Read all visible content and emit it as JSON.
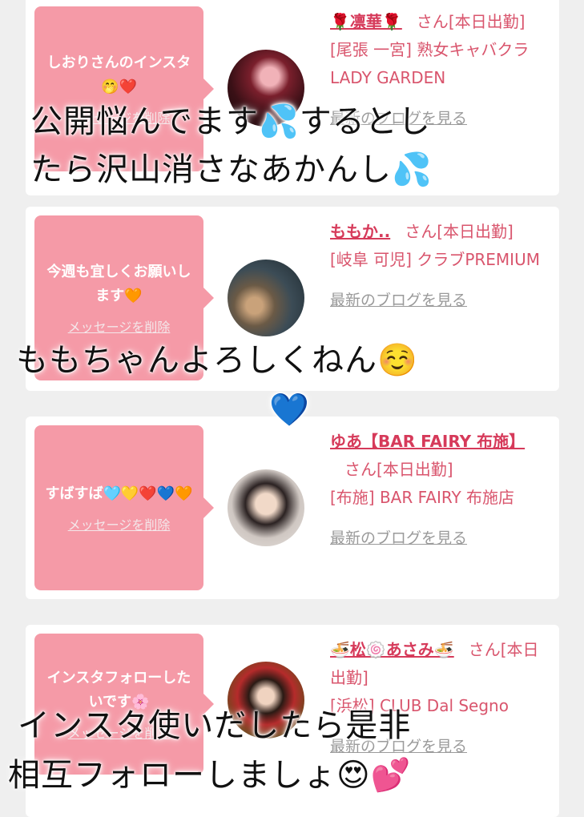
{
  "cards": [
    {
      "bubble_message": "しおりさんのインスタ🤭❤️",
      "delete_label": "メッセージを削除",
      "name": "🌹凛華🌹",
      "honorific": "さん",
      "status": "[本日出勤]",
      "location": "[尾張 一宮] 熟女キャバクラ LADY GARDEN",
      "blog_link": "最新のブログを見る"
    },
    {
      "bubble_message": "今週も宜しくお願いします🧡",
      "delete_label": "メッセージを削除",
      "name": "ももか..",
      "honorific": "さん",
      "status": "[本日出勤]",
      "location": "[岐阜 可児] クラブPREMIUM",
      "blog_link": "最新のブログを見る"
    },
    {
      "bubble_message": "すばすば🩵💛❤️💙🧡",
      "delete_label": "メッセージを削除",
      "name": "ゆあ【BAR FAIRY 布施】",
      "honorific": "さん",
      "status": "[本日出勤]",
      "location": "[布施] BAR FAIRY 布施店",
      "blog_link": "最新のブログを見る"
    },
    {
      "bubble_message": "インスタフォローしたいです🌸",
      "delete_label": "メッセージを削除",
      "name": "🍜松🍥あさみ🍜",
      "honorific": "さん",
      "status": "[本日出勤]",
      "location": "[浜松] CLUB Dal Segno",
      "blog_link": "最新のブログを見る"
    }
  ],
  "overlays": {
    "line1": "公開悩んでます💦するとし",
    "line2": "たら沢山消さなあかんし💦",
    "line3": "ももちゃんよろしくねん☺️",
    "line4": "💙",
    "line5": "インスタ使いだしたら是非",
    "line6": "相互フォローしましょ😍💕"
  },
  "colors": {
    "bubble": "#f59aa7",
    "accent": "#d63a5a",
    "background": "#efefef"
  }
}
